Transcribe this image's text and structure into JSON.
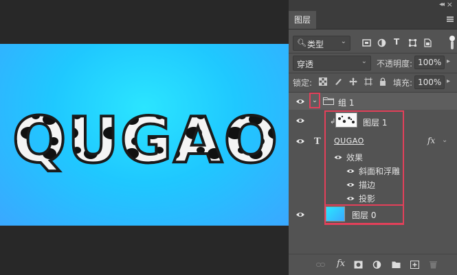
{
  "canvas": {
    "artwork_text": "QUGAO",
    "background_colors": [
      "#2be5ff",
      "#3aa8ff"
    ]
  },
  "panel": {
    "tab_label": "图层",
    "filter": {
      "kind_label": "类型"
    },
    "blend_mode": "穿透",
    "opacity_label": "不透明度:",
    "opacity_value": "100%",
    "lock_label": "锁定:",
    "fill_label": "填充:",
    "fill_value": "100%"
  },
  "layers": {
    "group": {
      "name": "组 1"
    },
    "layer1": {
      "name": "图层 1"
    },
    "text_layer": {
      "name": "QUGAO",
      "fx": "fx"
    },
    "effects": {
      "header": "效果",
      "items": [
        "斜面和浮雕",
        "描边",
        "投影"
      ]
    },
    "layer0": {
      "name": "图层 0"
    }
  },
  "colors": {
    "highlight": "#e4405a",
    "panel_bg": "#535353",
    "workspace_bg": "#282828"
  },
  "bottom_bar_icons": [
    "link-icon",
    "fx-icon",
    "mask-icon",
    "adjustment-icon",
    "folder-icon",
    "new-layer-icon",
    "trash-icon"
  ]
}
